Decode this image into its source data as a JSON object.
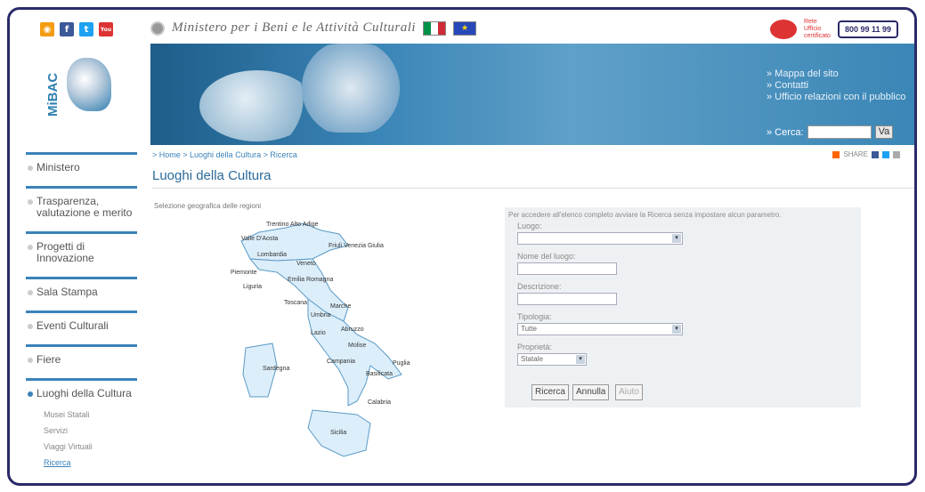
{
  "header": {
    "ministry_title": "Ministero per i Beni e le Attività Culturali",
    "phone": "800 99 11 99",
    "quality_text": "Rete\nUfficio\ncertificato",
    "social": [
      {
        "icon": "rss-icon",
        "glyph": "◉",
        "color": "#f39c12"
      },
      {
        "icon": "facebook-icon",
        "glyph": "f",
        "color": "#3b5998"
      },
      {
        "icon": "twitter-icon",
        "glyph": "t",
        "color": "#1da1f2"
      },
      {
        "icon": "youtube-icon",
        "glyph": "You",
        "color": "#d33"
      }
    ]
  },
  "logo": {
    "text": "MiBAC"
  },
  "banner_links": {
    "l1": "» Mappa del sito",
    "l2": "» Contatti",
    "l3": "» Ufficio relazioni con il pubblico",
    "search_label": "» Cerca:",
    "go": "Va"
  },
  "sidebar": {
    "items": [
      {
        "label": "Ministero"
      },
      {
        "label": "Trasparenza, valutazione e merito"
      },
      {
        "label": "Progetti di Innovazione"
      },
      {
        "label": "Sala Stampa"
      },
      {
        "label": "Eventi Culturali"
      },
      {
        "label": "Fiere"
      },
      {
        "label": "Luoghi della Cultura"
      }
    ],
    "sub": [
      {
        "label": "Musei Statali"
      },
      {
        "label": "Servizi"
      },
      {
        "label": "Viaggi Virtuali"
      },
      {
        "label": "Ricerca"
      }
    ]
  },
  "breadcrumb": "> Home > Luoghi della Cultura > Ricerca",
  "share": "SHARE",
  "page_title": "Luoghi della Cultura",
  "geo_label": "Selezione geografica delle regioni",
  "regions": [
    "Valle D'Aosta",
    "Trentino Alto Adige",
    "Friuli Venezia Giulia",
    "Lombardia",
    "Veneto",
    "Piemonte",
    "Emilia Romagna",
    "Liguria",
    "Toscana",
    "Marche",
    "Umbria",
    "Lazio",
    "Abruzzo",
    "Molise",
    "Sardegna",
    "Campania",
    "Puglia",
    "Basilicata",
    "Calabria",
    "Sicilia"
  ],
  "form": {
    "note": "Per accedere all'elenco completo avviare la Ricerca senza impostare alcun parametro.",
    "luogo_label": "Luogo:",
    "luogo_value": "",
    "nome_label": "Nome del luogo:",
    "descr_label": "Descrizione:",
    "tipologia_label": "Tipologia:",
    "tipologia_value": "Tutte",
    "proprieta_label": "Proprietà:",
    "proprieta_value": "Statale",
    "buttons": {
      "search": "Ricerca",
      "cancel": "Annulla",
      "help": "Aiuto"
    }
  }
}
